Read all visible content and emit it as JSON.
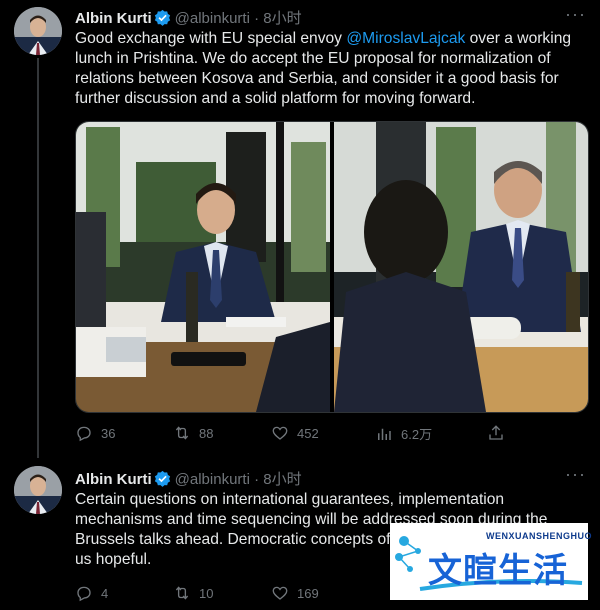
{
  "tweets": [
    {
      "author": {
        "name": "Albin Kurti",
        "handle": "@albinkurti",
        "time": "· 8小时"
      },
      "text_before_mention": "Good exchange with EU special envoy ",
      "mention": "@MiroslavLajcak",
      "text_after_mention": " over a working lunch in Prishtina. We do accept the EU proposal for normalization of relations between Kosova and Serbia, and consider it a good basis for further discussion and a solid platform for moving forward.",
      "stats": {
        "replies": "36",
        "retweets": "88",
        "likes": "452",
        "views": "6.2万"
      },
      "icons": [
        "reply-icon",
        "retweet-icon",
        "like-icon",
        "views-icon",
        "share-icon"
      ]
    },
    {
      "author": {
        "name": "Albin Kurti",
        "handle": "@albinkurti",
        "time": "· 8小时"
      },
      "text": "Certain questions on international guarantees, implementation mechanisms and time sequencing will be addressed soon during the Brussels talks ahead. Democratic concepts of",
      "text_tail": "us hopeful.",
      "stats": {
        "replies": "4",
        "retweets": "10",
        "likes": "169"
      }
    }
  ],
  "more_label": "···",
  "watermark": {
    "latin": "WENXUANSHENGHUO",
    "cn": "文暄生活"
  },
  "colors": {
    "background": "#000000",
    "text": "#e7e9ea",
    "muted": "#71767b",
    "accent": "#1d9bf0"
  }
}
